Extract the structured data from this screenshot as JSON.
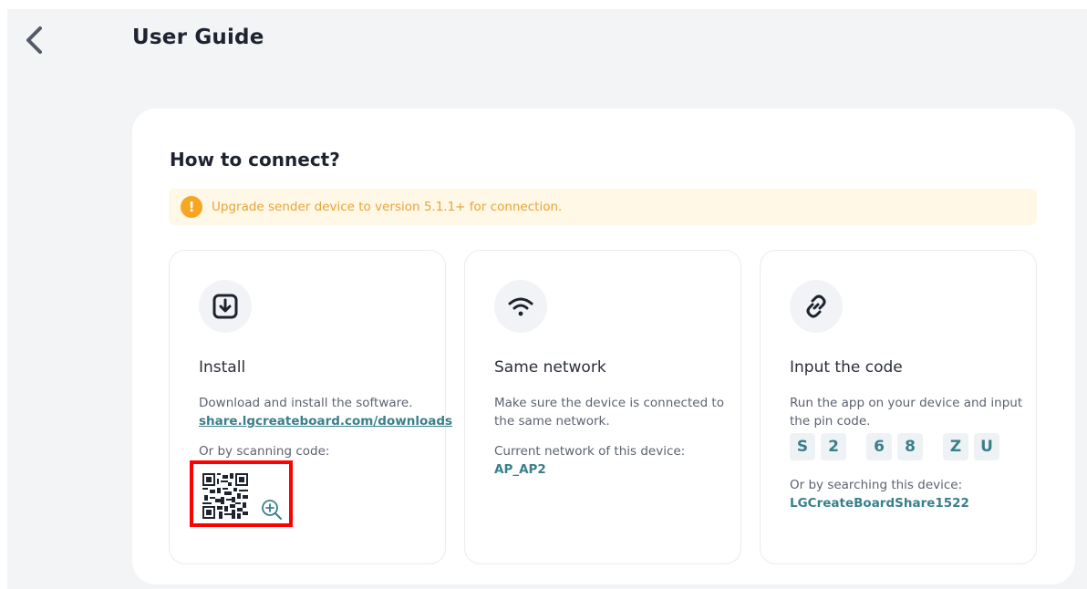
{
  "header": {
    "title": "User Guide"
  },
  "card": {
    "title": "How to connect?",
    "warning": "Upgrade sender device to version 5.1.1+ for connection."
  },
  "steps": {
    "install": {
      "heading": "Install",
      "desc": "Download and install the software.",
      "link": "share.lgcreateboard.com/downloads",
      "scan_label": "Or by scanning code:"
    },
    "network": {
      "heading": "Same network",
      "desc": "Make sure the device is connected to the same network.",
      "current_label": "Current network of this device:",
      "current_value": "AP_AP2"
    },
    "code": {
      "heading": "Input the code",
      "desc": "Run the app on your device and input the pin code.",
      "pin": [
        "S",
        "2",
        "6",
        "8",
        "Z",
        "U"
      ],
      "search_label": "Or by searching this device:",
      "search_value": "LGCreateBoardShare1522"
    }
  },
  "icons": {
    "back": "chevron-left-icon",
    "warning": "exclamation-icon",
    "install": "download-icon",
    "network": "wifi-icon",
    "code": "link-icon",
    "zoom": "zoom-in-icon"
  },
  "colors": {
    "accent": "#3a7f8c",
    "warning": "#f5a623",
    "highlight": "#ff0000"
  }
}
